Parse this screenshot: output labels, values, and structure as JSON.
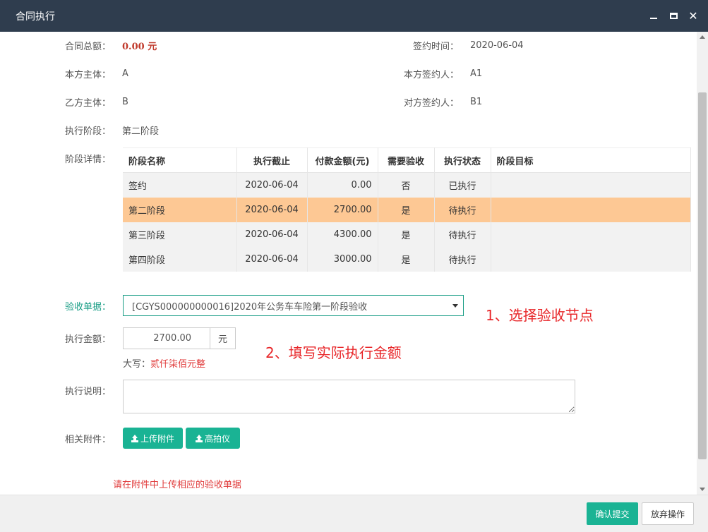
{
  "dialog": {
    "title": "合同执行"
  },
  "info": {
    "total_label": "合同总额：",
    "total_value": "0.00 元",
    "sign_time_label": "签约时间：",
    "sign_time_value": "2020-06-04",
    "our_party_label": "本方主体：",
    "our_party_value": "A",
    "our_signer_label": "本方签约人：",
    "our_signer_value": "A1",
    "other_party_label": "乙方主体：",
    "other_party_value": "B",
    "other_signer_label": "对方签约人：",
    "other_signer_value": "B1",
    "stage_label": "执行阶段：",
    "stage_value": "第二阶段",
    "detail_label": "阶段详情："
  },
  "stage_table": {
    "headers": [
      "阶段名称",
      "执行截止",
      "付款金额(元)",
      "需要验收",
      "执行状态",
      "阶段目标"
    ],
    "rows": [
      {
        "name": "签约",
        "deadline": "2020-06-04",
        "amount": "0.00",
        "acceptance": "否",
        "status": "已执行",
        "goal": ""
      },
      {
        "name": "第二阶段",
        "deadline": "2020-06-04",
        "amount": "2700.00",
        "acceptance": "是",
        "status": "待执行",
        "goal": ""
      },
      {
        "name": "第三阶段",
        "deadline": "2020-06-04",
        "amount": "4300.00",
        "acceptance": "是",
        "status": "待执行",
        "goal": ""
      },
      {
        "name": "第四阶段",
        "deadline": "2020-06-04",
        "amount": "3000.00",
        "acceptance": "是",
        "status": "待执行",
        "goal": ""
      }
    ]
  },
  "form": {
    "acceptance_label": "验收单据：",
    "acceptance_selected": "[CGYS000000000016]2020年公务车车险第一阶段验收",
    "amount_label": "执行金额：",
    "amount_value": "2700.00",
    "amount_unit": "元",
    "capital_label": "大写：",
    "capital_value": "贰仟柒佰元整",
    "desc_label": "执行说明：",
    "desc_value": "",
    "attach_label": "相关附件：",
    "upload_button": "上传附件",
    "camera_button": "高拍仪",
    "hint": "请在附件中上传相应的验收单据"
  },
  "annotations": {
    "step1": "1、选择验收节点",
    "step2": "2、填写实际执行金额"
  },
  "footer": {
    "confirm_button": "确认提交",
    "cancel_button": "放弃操作"
  },
  "colors": {
    "titlebar": "#2f3d4e",
    "primary": "#1ab394",
    "highlight_row": "#fdc894",
    "danger": "#e03a3a",
    "success": "#2e8b2e"
  }
}
